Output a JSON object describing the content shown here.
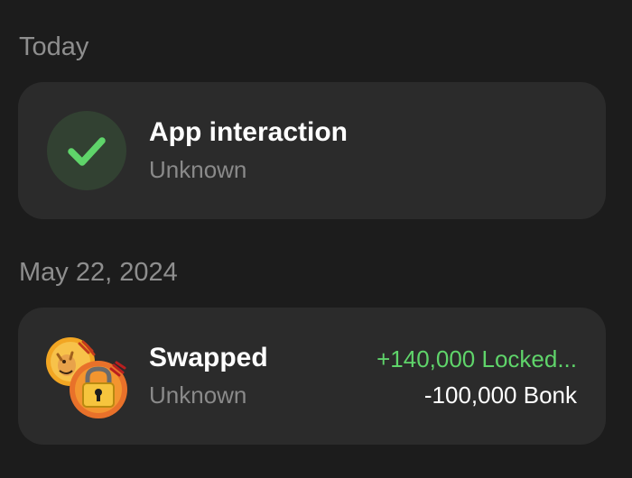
{
  "sections": [
    {
      "date": "Today",
      "activity": {
        "title": "App interaction",
        "subtitle": "Unknown",
        "icon": "check-icon"
      }
    },
    {
      "date": "May 22, 2024",
      "activity": {
        "title": "Swapped",
        "subtitle": "Unknown",
        "amount_received": "+140,000 Locked...",
        "amount_sent": "-100,000 Bonk",
        "icons": [
          "bonk-token-icon",
          "locked-token-icon"
        ]
      }
    }
  ],
  "colors": {
    "background": "#1c1c1c",
    "card": "#2b2b2b",
    "positive": "#5fd46a",
    "muted": "#8e8e8e"
  }
}
